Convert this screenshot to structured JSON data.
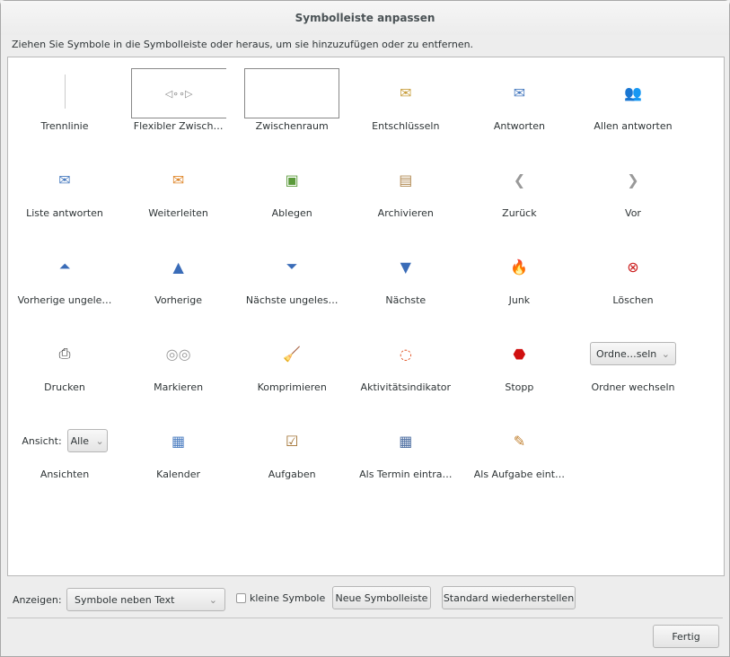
{
  "title": "Symbolleiste anpassen",
  "hint": "Ziehen Sie Symbole in die Symbolleiste oder heraus, um sie hinzuzufügen oder zu entfernen.",
  "items": [
    {
      "label": "Trennlinie",
      "icon": "separator-icon"
    },
    {
      "label": "Flexibler Zwisch…",
      "icon": "flexible-space-icon"
    },
    {
      "label": "Zwischenraum",
      "icon": "space-icon"
    },
    {
      "label": "Entschlüsseln",
      "icon": "decrypt-icon"
    },
    {
      "label": "Antworten",
      "icon": "reply-icon"
    },
    {
      "label": "Allen antworten",
      "icon": "reply-all-icon"
    },
    {
      "label": "Liste antworten",
      "icon": "reply-list-icon"
    },
    {
      "label": "Weiterleiten",
      "icon": "forward-icon"
    },
    {
      "label": "Ablegen",
      "icon": "file-icon"
    },
    {
      "label": "Archivieren",
      "icon": "archive-icon"
    },
    {
      "label": "Zurück",
      "icon": "back-icon"
    },
    {
      "label": "Vor",
      "icon": "forward-arrow-icon"
    },
    {
      "label": "Vorherige ungele…",
      "icon": "prev-unread-icon"
    },
    {
      "label": "Vorherige",
      "icon": "prev-icon"
    },
    {
      "label": "Nächste ungeles…",
      "icon": "next-unread-icon"
    },
    {
      "label": "Nächste",
      "icon": "next-icon"
    },
    {
      "label": "Junk",
      "icon": "junk-icon"
    },
    {
      "label": "Löschen",
      "icon": "delete-icon"
    },
    {
      "label": "Drucken",
      "icon": "print-icon"
    },
    {
      "label": "Markieren",
      "icon": "mark-icon"
    },
    {
      "label": "Komprimieren",
      "icon": "compact-icon"
    },
    {
      "label": "Aktivitätsindikator",
      "icon": "throbber-icon"
    },
    {
      "label": "Stopp",
      "icon": "stop-icon"
    },
    {
      "label": "Ordner wechseln",
      "icon": "folder-select"
    },
    {
      "label": "Ansichten",
      "icon": "view-select"
    },
    {
      "label": "Kalender",
      "icon": "calendar-icon"
    },
    {
      "label": "Aufgaben",
      "icon": "tasks-icon"
    },
    {
      "label": "Als Termin eintra…",
      "icon": "convert-event-icon"
    },
    {
      "label": "Als Aufgabe eint…",
      "icon": "convert-task-icon"
    }
  ],
  "folder_select_value": "Ordne…seln",
  "view_label": "Ansicht:",
  "view_select_value": "Alle",
  "footer": {
    "show_label": "Anzeigen:",
    "show_value": "Symbole neben Text",
    "small_icons": "kleine Symbole",
    "small_icons_checked": false,
    "new_toolbar": "Neue Symbolleiste",
    "restore": "Standard wiederherstellen",
    "done": "Fertig"
  }
}
